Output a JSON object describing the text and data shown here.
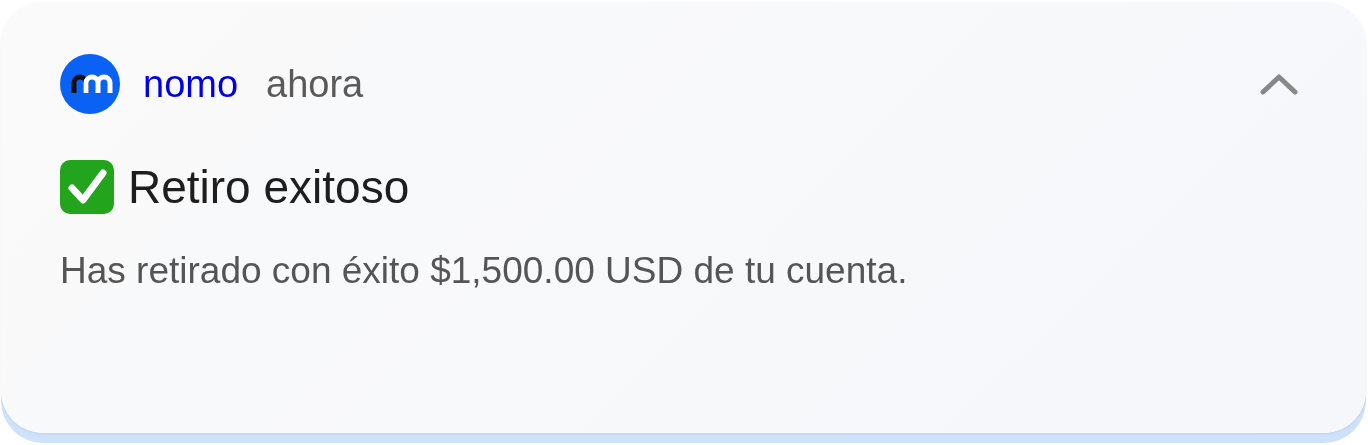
{
  "notification": {
    "app_name": "nomo",
    "time": "ahora",
    "expanded": true,
    "title": "Retiro exitoso",
    "message": "Has retirado con éxito $1,500.00 USD de tu cuenta."
  }
}
